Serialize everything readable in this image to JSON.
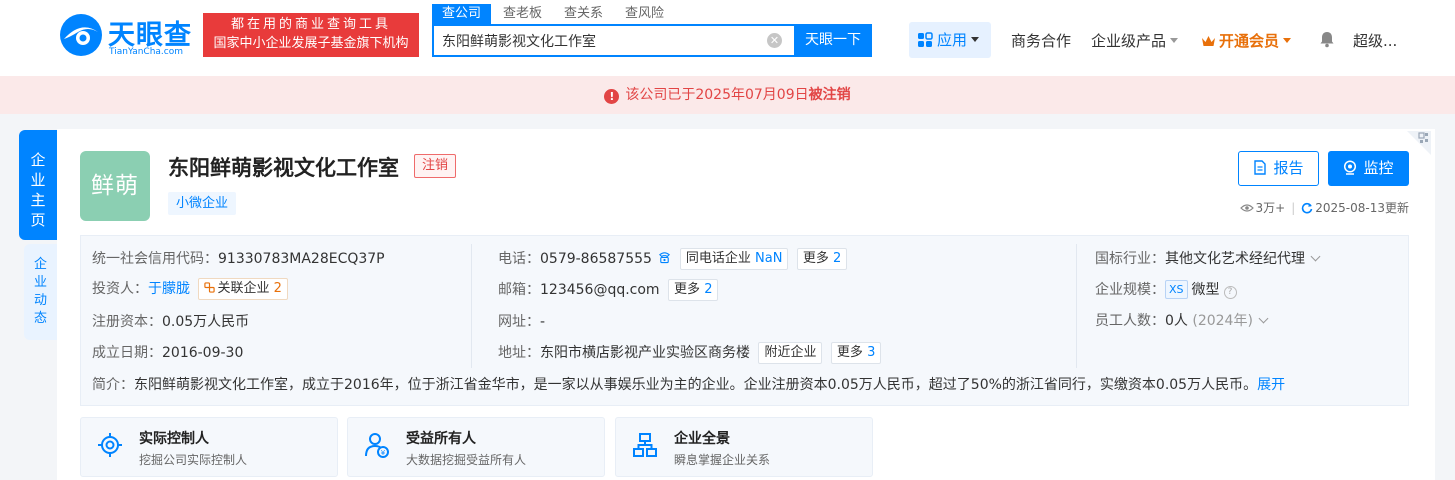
{
  "brand": {
    "name_cn": "天眼查",
    "name_en": "TianYanCha.com",
    "slogan_line1": "都在用的商业查询工具",
    "slogan_line2": "国家中小企业发展子基金旗下机构"
  },
  "search": {
    "tabs": [
      "查公司",
      "查老板",
      "查关系",
      "查风险"
    ],
    "active_tab": 0,
    "query": "东阳鲜萌影视文化工作室",
    "button_label": "天眼一下"
  },
  "nav": {
    "apps_label": "应用",
    "business_label": "商务合作",
    "enterprise_label": "企业级产品",
    "vip_label": "开通会员",
    "user_label": "超级..."
  },
  "banner": {
    "text_prefix": "该公司已于2025年07月09日",
    "text_bold": "被注销"
  },
  "side_tabs": {
    "home": "企业主页",
    "news": "企业动态"
  },
  "company": {
    "avatar_text": "鲜萌",
    "name": "东阳鲜萌影视文化工作室",
    "status": "注销",
    "tag": "小微企业",
    "report_label": "报告",
    "monitor_label": "监控",
    "views": "3万+",
    "updated": "2025-08-13更新"
  },
  "info": {
    "credit_code_label": "统一社会信用代码：",
    "credit_code": "91330783MA28ECQ37P",
    "investor_label": "投资人：",
    "investor": "于朦胧",
    "related_label": "关联企业",
    "related_count": "2",
    "capital_label": "注册资本：",
    "capital": "0.05万人民币",
    "founded_label": "成立日期：",
    "founded": "2016-09-30",
    "phone_label": "电话：",
    "phone": "0579-86587555",
    "same_phone_label": "同电话企业",
    "same_phone_count": "NaN",
    "phone_more_label": "更多",
    "phone_more_count": "2",
    "email_label": "邮箱：",
    "email": "123456@qq.com",
    "email_more_label": "更多",
    "email_more_count": "2",
    "website_label": "网址：",
    "website": "-",
    "address_label": "地址：",
    "address": "东阳市横店影视产业实验区商务楼",
    "nearby_label": "附近企业",
    "address_more_label": "更多",
    "address_more_count": "3",
    "industry_label": "国标行业：",
    "industry": "其他文化艺术经纪代理",
    "scale_label": "企业规模：",
    "scale_tag": "XS",
    "scale": "微型",
    "staff_label": "员工人数：",
    "staff": "0人",
    "staff_year": "(2024年)",
    "intro_label": "简介：",
    "intro": "东阳鲜萌影视文化工作室，成立于2016年，位于浙江省金华市，是一家以从事娱乐业为主的企业。企业注册资本0.05万人民币，超过了50%的浙江省同行，实缴资本0.05万人民币。",
    "expand_label": "展开"
  },
  "features": [
    {
      "title": "实际控制人",
      "desc": "挖掘公司实际控制人",
      "icon": "target-icon"
    },
    {
      "title": "受益所有人",
      "desc": "大数据挖掘受益所有人",
      "icon": "beneficiary-icon"
    },
    {
      "title": "企业全景",
      "desc": "瞬息掌握企业关系",
      "icon": "org-chart-icon"
    }
  ],
  "colors": {
    "brand_blue": "#0084ff",
    "alert_red": "#e24545",
    "vip_orange": "#e8700a",
    "avatar_green": "#8bcfb2"
  }
}
